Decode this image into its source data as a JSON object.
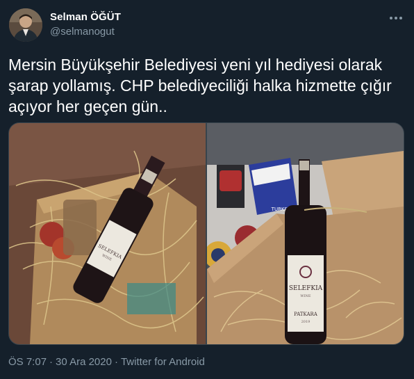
{
  "author": {
    "name": "Selman ÖĞÜT",
    "handle": "@selmanogut",
    "avatar_icon": "profile-photo"
  },
  "tweet": {
    "line1": "Mersin Büyükşehir Belediyesi yeni yıl hediyesi olarak",
    "line2": "şarap yollamış. CHP belediyeciliği halka hizmette çığır",
    "line3": "açıyor her geçen gün.."
  },
  "media": {
    "left_photo": {
      "label_brand": "SELEFKIA",
      "label_sub": "WINE"
    },
    "right_photo": {
      "label_brand": "SELEFKIA",
      "label_sub": "WINE",
      "label_variety": "PATKARA",
      "label_year": "2019",
      "box_text": "TURKSERI"
    }
  },
  "meta": {
    "time": "ÖS 7:07",
    "date": "30 Ara 2020",
    "source": "Twitter for Android",
    "separator": "·"
  },
  "colors": {
    "background": "#15202b",
    "secondary_text": "#8899a6",
    "border": "#38444d"
  }
}
